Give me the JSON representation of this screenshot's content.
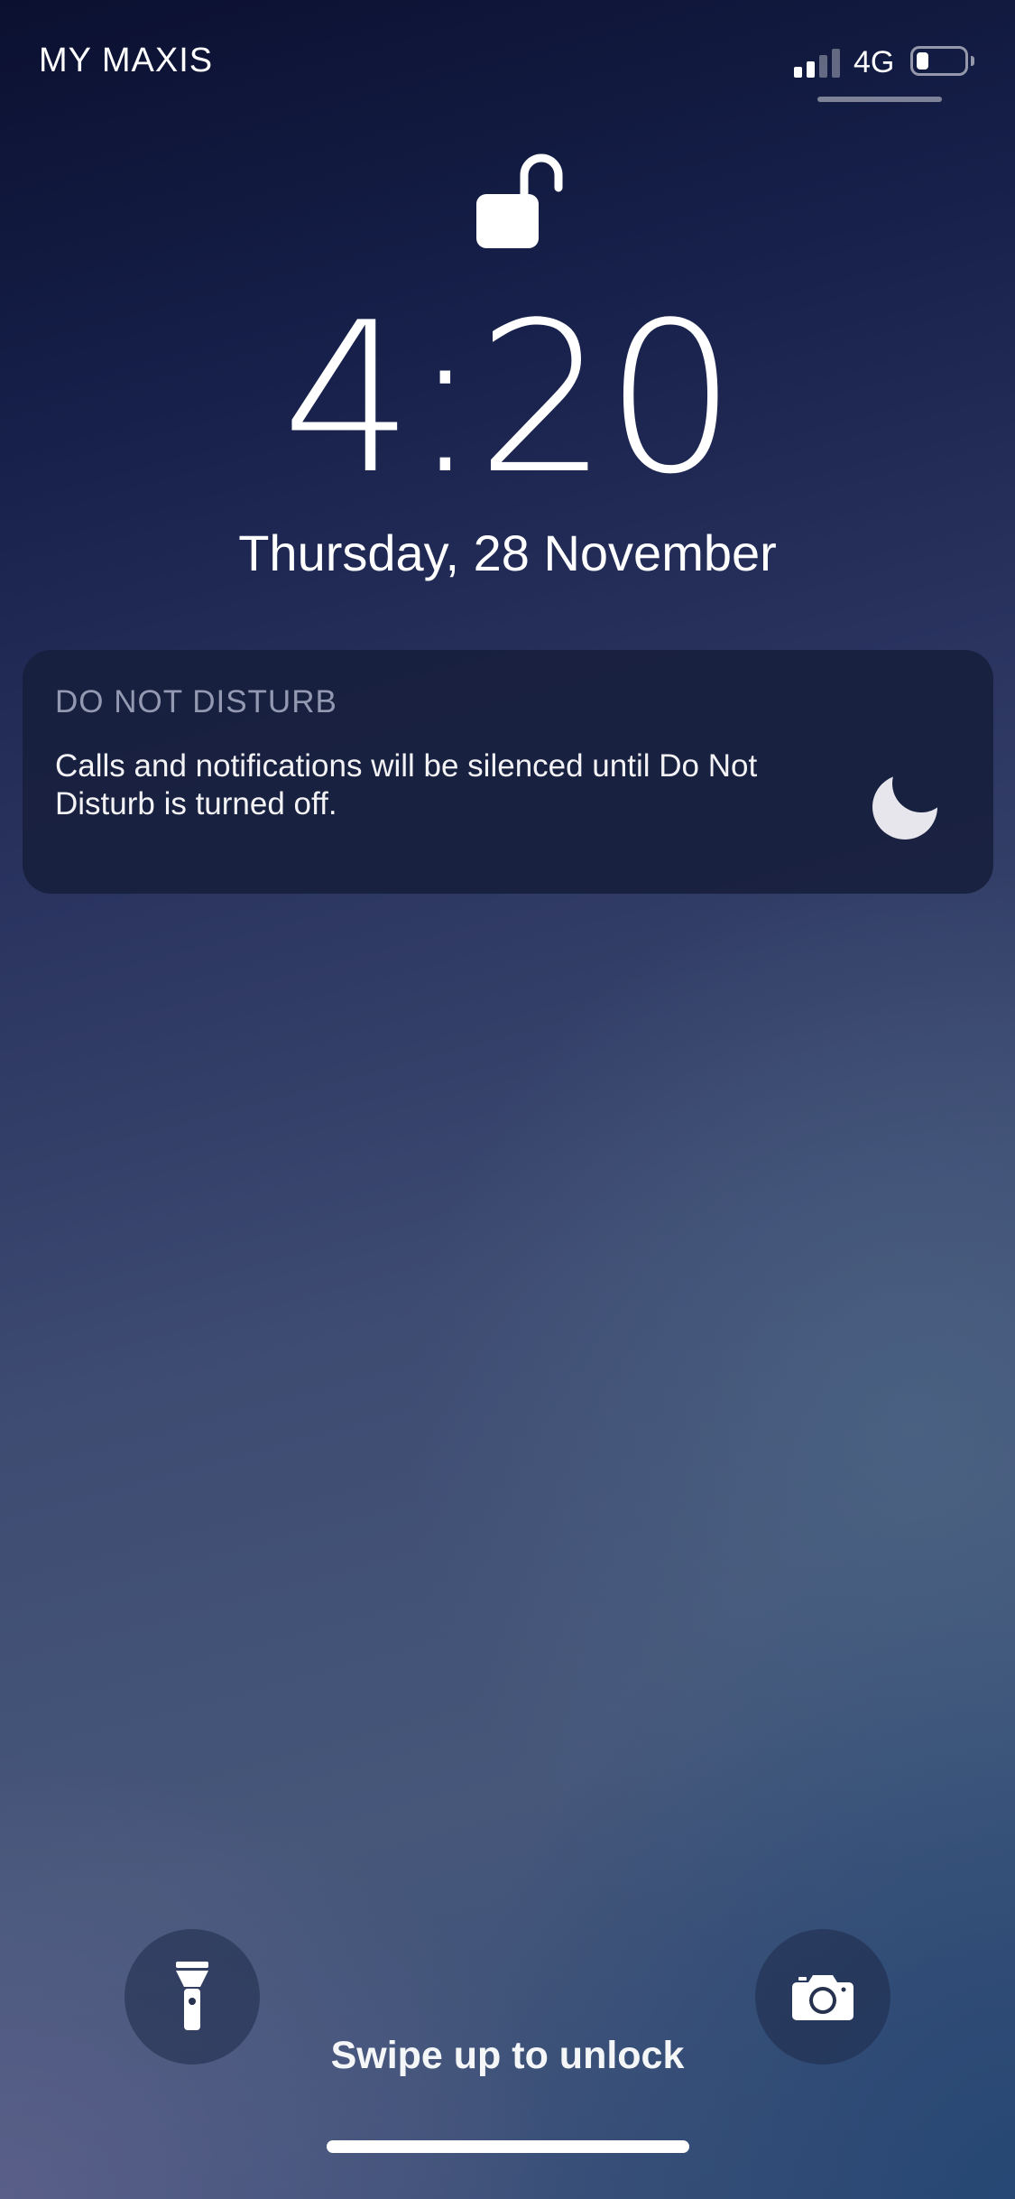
{
  "status_bar": {
    "carrier": "MY MAXIS",
    "network": "4G",
    "signal_bars_active": 2,
    "signal_bars_total": 4,
    "battery_level": 0.25
  },
  "lock_screen": {
    "lock_icon": "unlocked-padlock-icon",
    "time": "4:20",
    "date": "Thursday, 28 November"
  },
  "notification": {
    "title": "DO NOT DISTURB",
    "body": "Calls and notifications will be silenced until Do Not Disturb is turned off.",
    "icon": "moon-icon"
  },
  "controls": {
    "flashlight_icon": "flashlight-icon",
    "camera_icon": "camera-icon",
    "swipe_hint": "Swipe up to unlock"
  },
  "colors": {
    "text": "#ffffff",
    "card_background": "#18203e",
    "button_background": "#1e2a48"
  }
}
